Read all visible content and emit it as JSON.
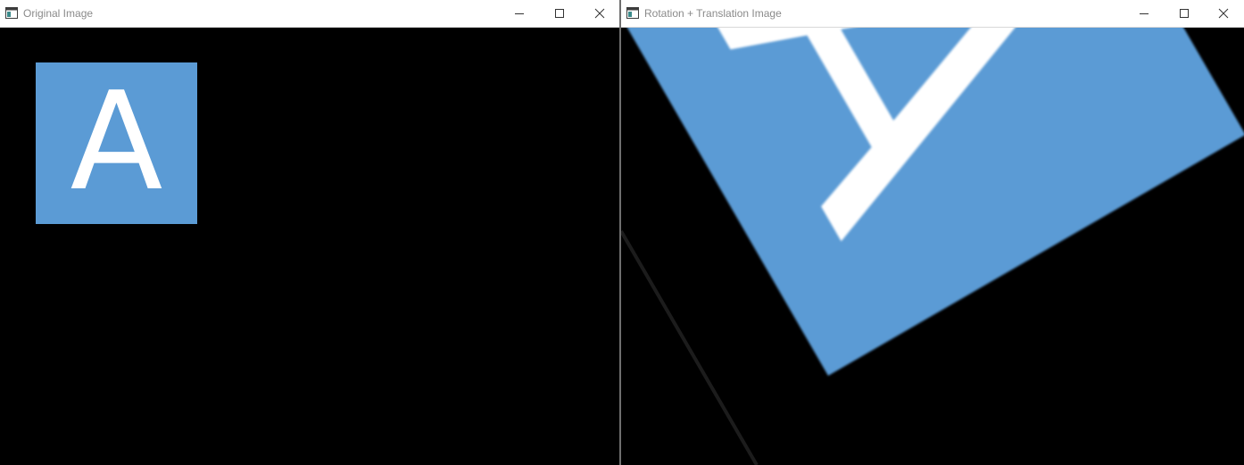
{
  "windows": [
    {
      "title": "Original Image",
      "controls": {
        "minimize": "minimize",
        "maximize": "maximize",
        "close": "close"
      },
      "image": {
        "letter": "A",
        "shape_color": "#5b9bd5",
        "letter_color": "#ffffff",
        "background": "#000000"
      }
    },
    {
      "title": "Rotation + Translation Image",
      "controls": {
        "minimize": "minimize",
        "maximize": "maximize",
        "close": "close"
      },
      "image": {
        "letter": "A",
        "shape_color": "#5b9bd5",
        "letter_color": "#ffffff",
        "background": "#000000"
      }
    }
  ],
  "colors": {
    "titlebar": "#ffffff",
    "title_text": "#8a8a8a",
    "accent_square": "#5b9bd5",
    "window_divider": "#6f6f6f"
  }
}
